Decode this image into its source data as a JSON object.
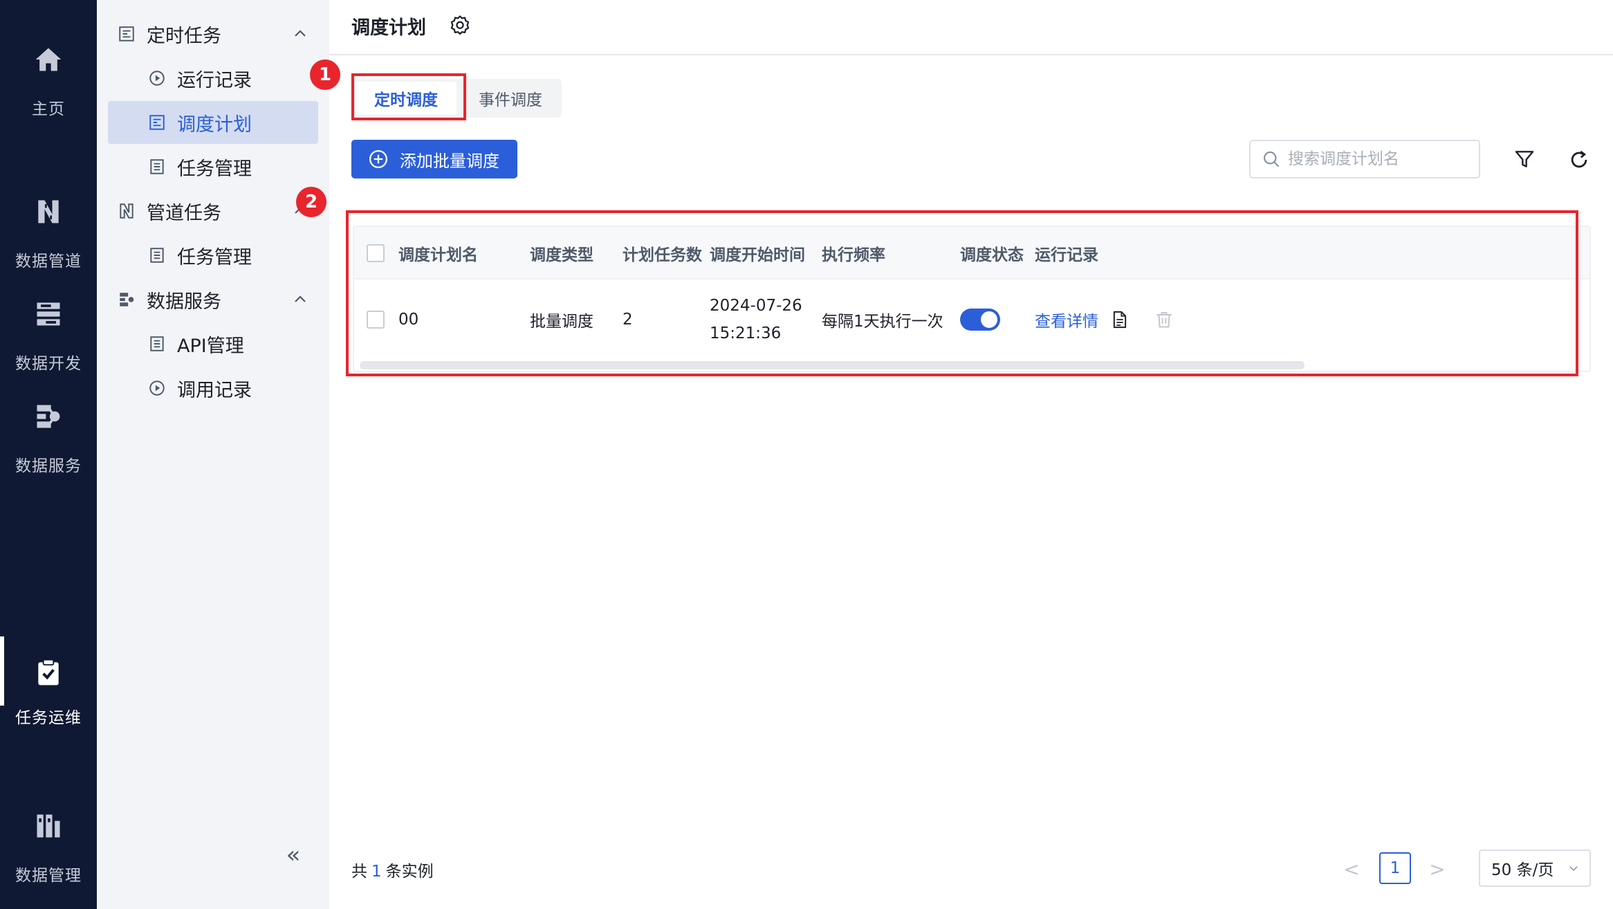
{
  "colors": {
    "primary": "#2b5fd9",
    "rail_bg": "#0f1933",
    "menu_bg": "#f2f4f8",
    "annotation": "#e8252d"
  },
  "rail": {
    "items": [
      {
        "label": "主页",
        "icon": "home-icon"
      },
      {
        "label": "数据管道",
        "icon": "pipeline-icon"
      },
      {
        "label": "数据开发",
        "icon": "data-dev-icon"
      },
      {
        "label": "数据服务",
        "icon": "data-service-icon"
      },
      {
        "label": "任务运维",
        "icon": "task-ops-icon",
        "active": true
      },
      {
        "label": "数据管理",
        "icon": "data-manage-icon"
      }
    ]
  },
  "menu": {
    "groups": [
      {
        "label": "定时任务",
        "icon": "scheduled-task-icon",
        "expanded": true,
        "children": [
          {
            "label": "运行记录",
            "icon": "play-record-icon"
          },
          {
            "label": "调度计划",
            "icon": "schedule-plan-icon",
            "selected": true
          },
          {
            "label": "任务管理",
            "icon": "task-list-icon"
          }
        ]
      },
      {
        "label": "管道任务",
        "icon": "pipeline-task-icon",
        "expanded": true,
        "children": [
          {
            "label": "任务管理",
            "icon": "task-list-icon"
          }
        ]
      },
      {
        "label": "数据服务",
        "icon": "data-service-menu-icon",
        "expanded": true,
        "children": [
          {
            "label": "API管理",
            "icon": "api-list-icon"
          },
          {
            "label": "调用记录",
            "icon": "call-record-icon"
          }
        ]
      }
    ],
    "collapse_label": "«"
  },
  "header": {
    "title": "调度计划",
    "settings_icon": "gear-icon"
  },
  "tabs": [
    {
      "label": "定时调度",
      "active": true
    },
    {
      "label": "事件调度",
      "active": false
    }
  ],
  "annotations": {
    "badge_1": "1",
    "badge_2": "2"
  },
  "toolbar": {
    "add_label": "添加批量调度",
    "search_placeholder": "搜索调度计划名",
    "filter_icon": "filter-icon",
    "refresh_icon": "refresh-icon"
  },
  "table": {
    "columns": [
      "调度计划名",
      "调度类型",
      "计划任务数",
      "调度开始时间",
      "执行频率",
      "调度状态",
      "运行记录"
    ],
    "rows": [
      {
        "name": "00",
        "type": "批量调度",
        "task_count": "2",
        "start_time": "2024-07-26 15:21:36",
        "frequency": "每隔1天执行一次",
        "status_on": true,
        "record_link": "查看详情"
      }
    ]
  },
  "footer": {
    "total_prefix": "共",
    "total_count": "1",
    "total_suffix": "条实例",
    "prev": "<",
    "next": ">",
    "current_page": "1",
    "page_size": "50 条/页"
  }
}
